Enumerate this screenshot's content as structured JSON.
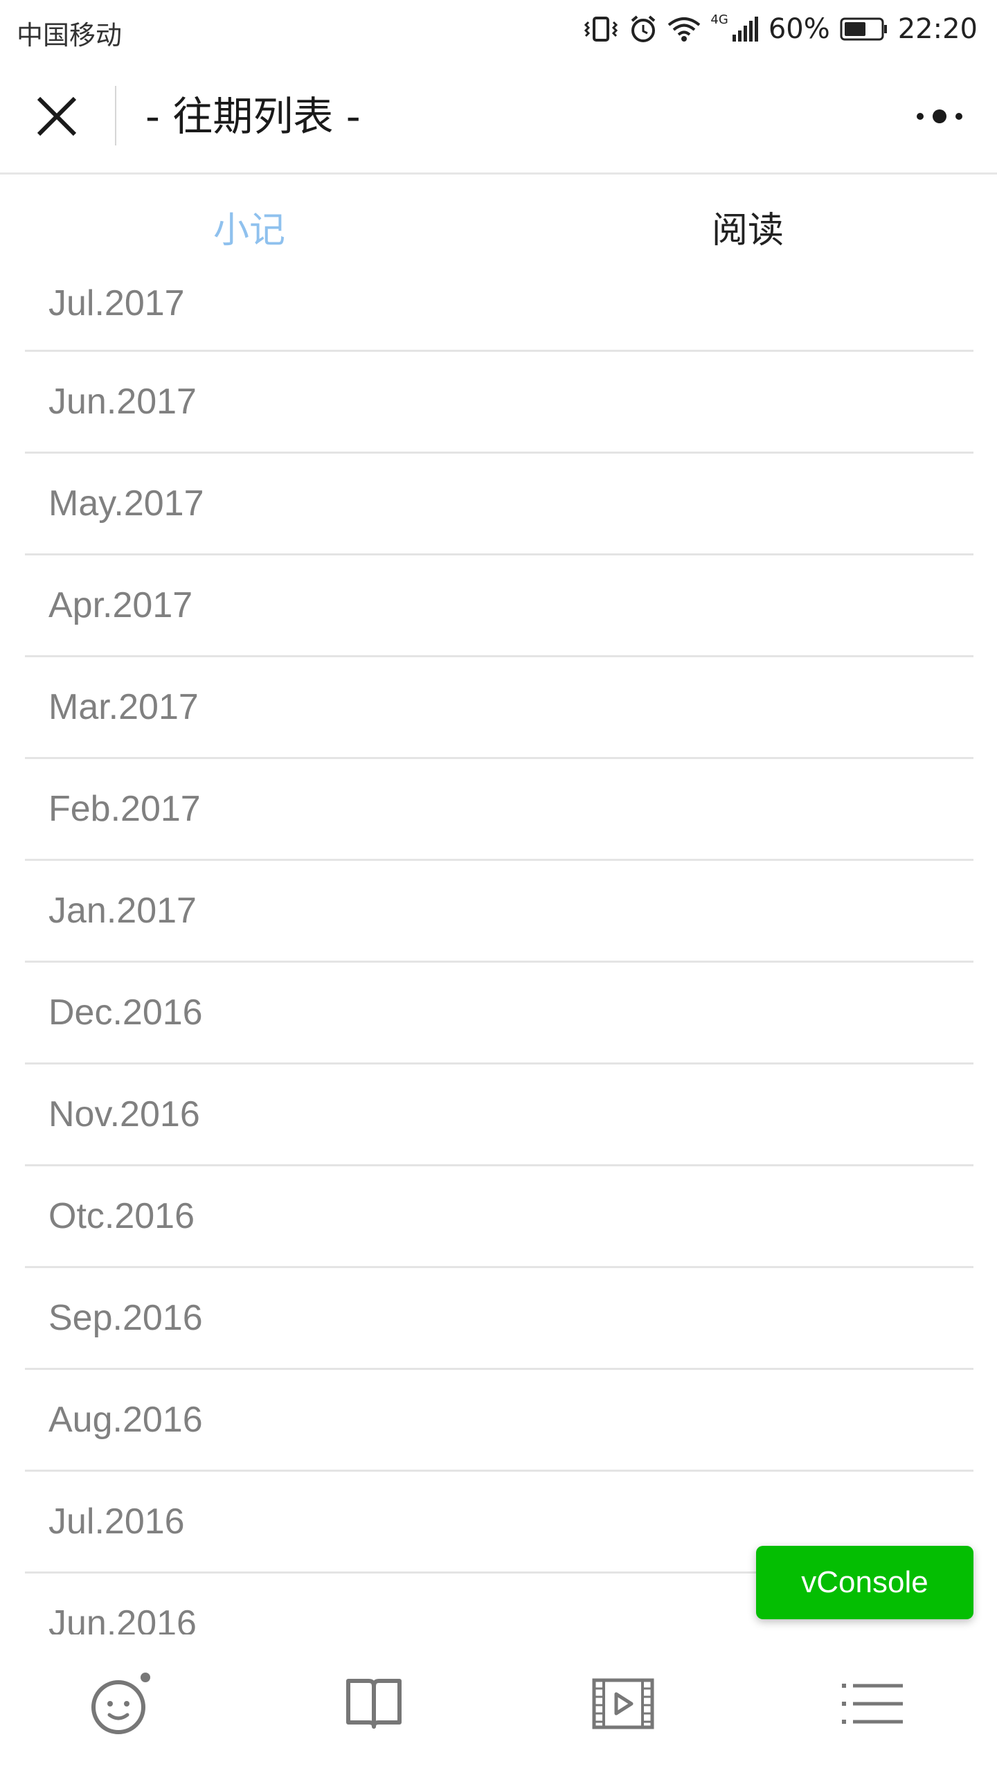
{
  "status_bar": {
    "carrier": "中国移动",
    "network_label": "4G",
    "battery_percent": "60%",
    "time": "22:20"
  },
  "nav": {
    "title": "- 往期列表 -"
  },
  "tabs": [
    {
      "label": "小记",
      "active": true
    },
    {
      "label": "阅读",
      "active": false
    }
  ],
  "months": [
    "Jul.2017",
    "Jun.2017",
    "May.2017",
    "Apr.2017",
    "Mar.2017",
    "Feb.2017",
    "Jan.2017",
    "Dec.2016",
    "Nov.2016",
    "Otc.2016",
    "Sep.2016",
    "Aug.2016",
    "Jul.2016",
    "Jun.2016"
  ],
  "vconsole": {
    "label": "vConsole"
  },
  "bottom_nav": [
    {
      "icon": "face-icon"
    },
    {
      "icon": "book-icon"
    },
    {
      "icon": "video-icon"
    },
    {
      "icon": "list-icon"
    }
  ],
  "colors": {
    "active_tab": "#8fc1ee",
    "vconsole_green": "#04be02",
    "list_text": "#808080",
    "icon_gray": "#777777"
  }
}
